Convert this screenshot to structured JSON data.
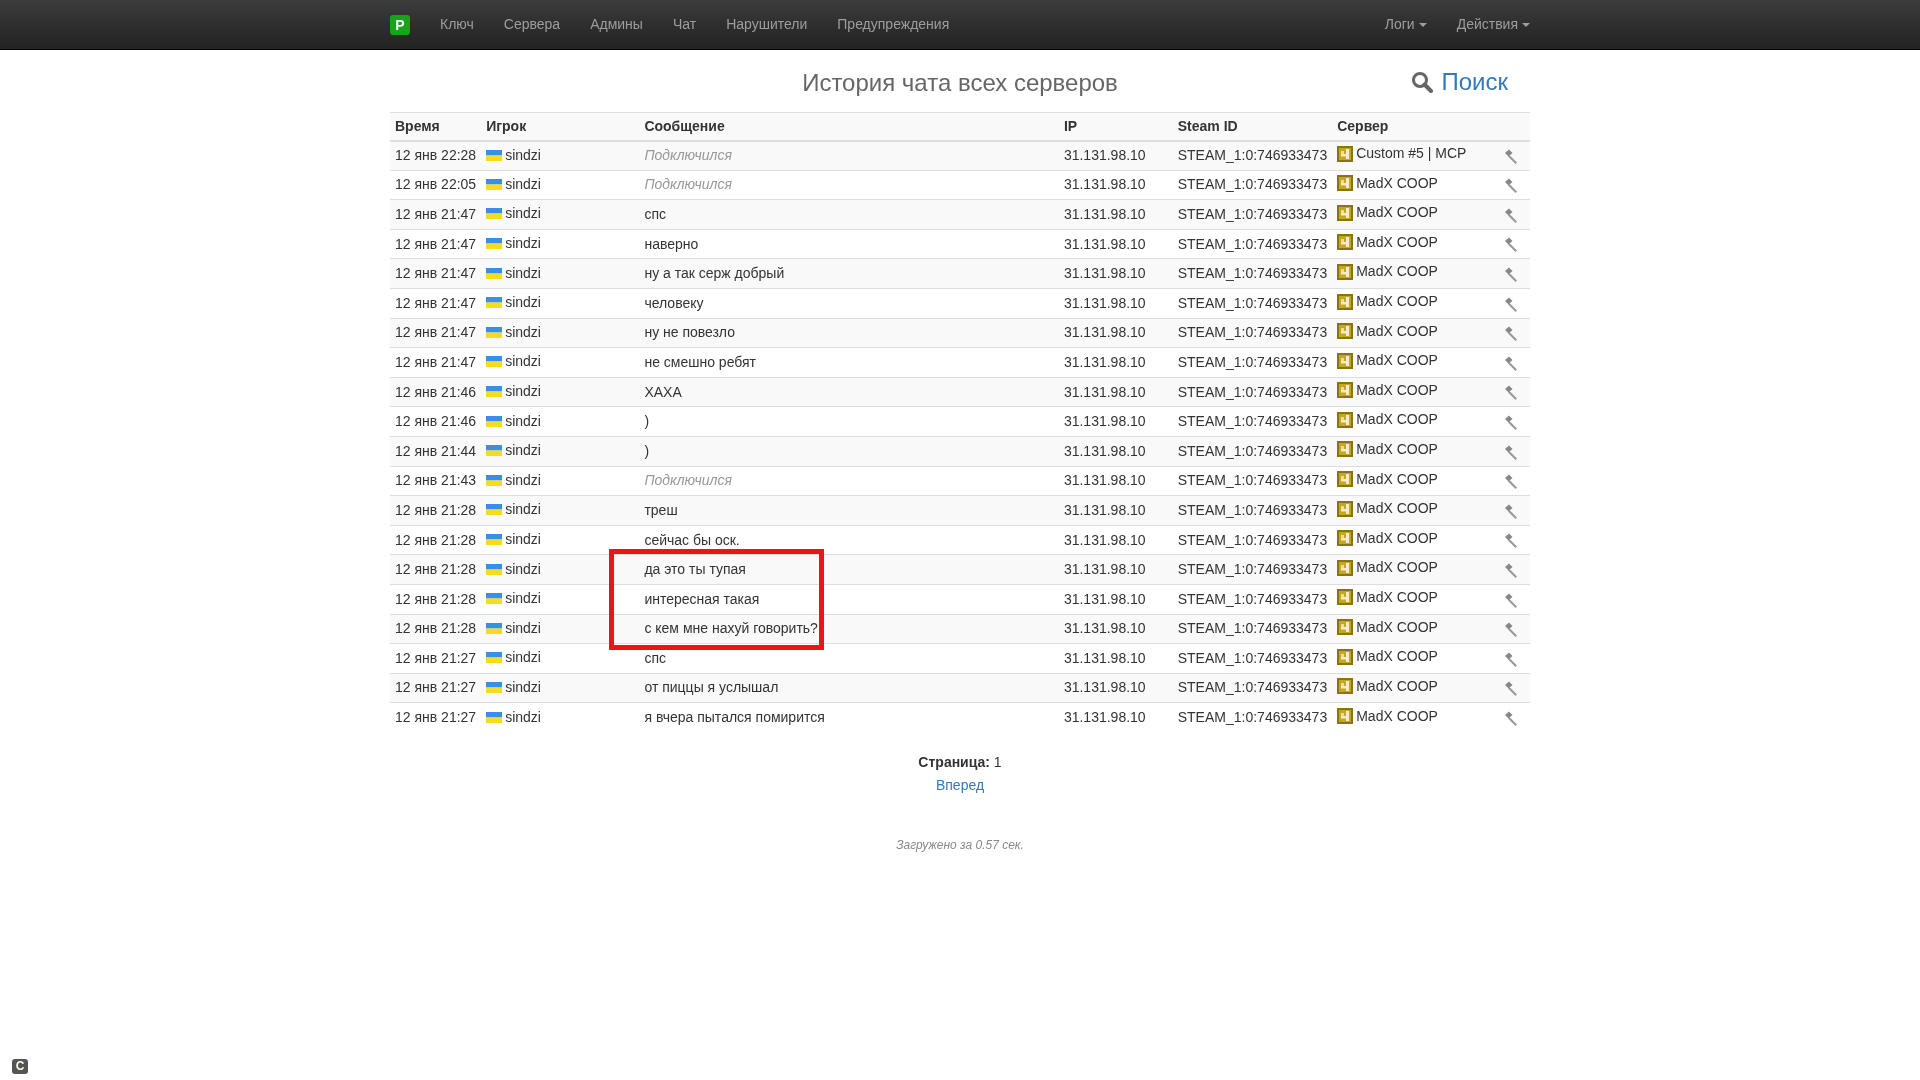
{
  "navbar": {
    "logo": "P",
    "items": [
      {
        "label": "Ключ"
      },
      {
        "label": "Сервера"
      },
      {
        "label": "Админы"
      },
      {
        "label": "Чат"
      },
      {
        "label": "Нарушители"
      },
      {
        "label": "Предупреждения"
      }
    ],
    "right_items": [
      {
        "label": "Логи"
      },
      {
        "label": "Действия"
      }
    ]
  },
  "page_title": "История чата всех серверов",
  "search_link": "Поиск",
  "table": {
    "columns": [
      "Время",
      "Игрок",
      "Сообщение",
      "IP",
      "Steam ID",
      "Сервер"
    ],
    "rows": [
      {
        "time": "12 янв 22:28",
        "player": "sindzi",
        "message": "Подключился",
        "kind": "connect",
        "ip": "31.131.98.10",
        "steam_id": "STEAM_1:0:746933473",
        "server": "Custom #5 | MCP",
        "marked": false
      },
      {
        "time": "12 янв 22:05",
        "player": "sindzi",
        "message": "Подключился",
        "kind": "connect",
        "ip": "31.131.98.10",
        "steam_id": "STEAM_1:0:746933473",
        "server": "MadX COOP",
        "marked": false
      },
      {
        "time": "12 янв 21:47",
        "player": "sindzi",
        "message": "спс",
        "kind": "chat",
        "ip": "31.131.98.10",
        "steam_id": "STEAM_1:0:746933473",
        "server": "MadX COOP",
        "marked": false
      },
      {
        "time": "12 янв 21:47",
        "player": "sindzi",
        "message": "наверно",
        "kind": "chat",
        "ip": "31.131.98.10",
        "steam_id": "STEAM_1:0:746933473",
        "server": "MadX COOP",
        "marked": false
      },
      {
        "time": "12 янв 21:47",
        "player": "sindzi",
        "message": "ну а так серж добрый",
        "kind": "chat",
        "ip": "31.131.98.10",
        "steam_id": "STEAM_1:0:746933473",
        "server": "MadX COOP",
        "marked": false
      },
      {
        "time": "12 янв 21:47",
        "player": "sindzi",
        "message": "человеку",
        "kind": "chat",
        "ip": "31.131.98.10",
        "steam_id": "STEAM_1:0:746933473",
        "server": "MadX COOP",
        "marked": false
      },
      {
        "time": "12 янв 21:47",
        "player": "sindzi",
        "message": "ну не повезло",
        "kind": "chat",
        "ip": "31.131.98.10",
        "steam_id": "STEAM_1:0:746933473",
        "server": "MadX COOP",
        "marked": false
      },
      {
        "time": "12 янв 21:47",
        "player": "sindzi",
        "message": "не смешно ребят",
        "kind": "chat",
        "ip": "31.131.98.10",
        "steam_id": "STEAM_1:0:746933473",
        "server": "MadX COOP",
        "marked": false
      },
      {
        "time": "12 янв 21:46",
        "player": "sindzi",
        "message": "ХАХА",
        "kind": "chat",
        "ip": "31.131.98.10",
        "steam_id": "STEAM_1:0:746933473",
        "server": "MadX COOP",
        "marked": false
      },
      {
        "time": "12 янв 21:46",
        "player": "sindzi",
        "message": ")",
        "kind": "chat",
        "ip": "31.131.98.10",
        "steam_id": "STEAM_1:0:746933473",
        "server": "MadX COOP",
        "marked": false
      },
      {
        "time": "12 янв 21:44",
        "player": "sindzi",
        "message": ")",
        "kind": "chat",
        "ip": "31.131.98.10",
        "steam_id": "STEAM_1:0:746933473",
        "server": "MadX COOP",
        "marked": false
      },
      {
        "time": "12 янв 21:43",
        "player": "sindzi",
        "message": "Подключился",
        "kind": "connect",
        "ip": "31.131.98.10",
        "steam_id": "STEAM_1:0:746933473",
        "server": "MadX COOP",
        "marked": false
      },
      {
        "time": "12 янв 21:28",
        "player": "sindzi",
        "message": "треш",
        "kind": "chat",
        "ip": "31.131.98.10",
        "steam_id": "STEAM_1:0:746933473",
        "server": "MadX COOP",
        "marked": false
      },
      {
        "time": "12 янв 21:28",
        "player": "sindzi",
        "message": "сейчас бы оск.",
        "kind": "chat",
        "ip": "31.131.98.10",
        "steam_id": "STEAM_1:0:746933473",
        "server": "MadX COOP",
        "marked": false
      },
      {
        "time": "12 янв 21:28",
        "player": "sindzi",
        "message": "да это ты тупая",
        "kind": "chat",
        "ip": "31.131.98.10",
        "steam_id": "STEAM_1:0:746933473",
        "server": "MadX COOP",
        "marked": true
      },
      {
        "time": "12 янв 21:28",
        "player": "sindzi",
        "message": "интересная такая",
        "kind": "chat",
        "ip": "31.131.98.10",
        "steam_id": "STEAM_1:0:746933473",
        "server": "MadX COOP",
        "marked": true
      },
      {
        "time": "12 янв 21:28",
        "player": "sindzi",
        "message": "с кем мне нахуй говорить?",
        "kind": "chat",
        "ip": "31.131.98.10",
        "steam_id": "STEAM_1:0:746933473",
        "server": "MadX COOP",
        "marked": true
      },
      {
        "time": "12 янв 21:27",
        "player": "sindzi",
        "message": "спс",
        "kind": "chat",
        "ip": "31.131.98.10",
        "steam_id": "STEAM_1:0:746933473",
        "server": "MadX COOP",
        "marked": false
      },
      {
        "time": "12 янв 21:27",
        "player": "sindzi",
        "message": "от пиццы я услышал",
        "kind": "chat",
        "ip": "31.131.98.10",
        "steam_id": "STEAM_1:0:746933473",
        "server": "MadX COOP",
        "marked": false
      },
      {
        "time": "12 янв 21:27",
        "player": "sindzi",
        "message": "я вчера пытался помирится",
        "kind": "chat",
        "ip": "31.131.98.10",
        "steam_id": "STEAM_1:0:746933473",
        "server": "MadX COOP",
        "marked": false
      }
    ]
  },
  "pagination": {
    "label": "Страница:",
    "page": "1",
    "next": "Вперед"
  },
  "footer": "Загружено за 0.57 сек.",
  "corner_badge": "C"
}
